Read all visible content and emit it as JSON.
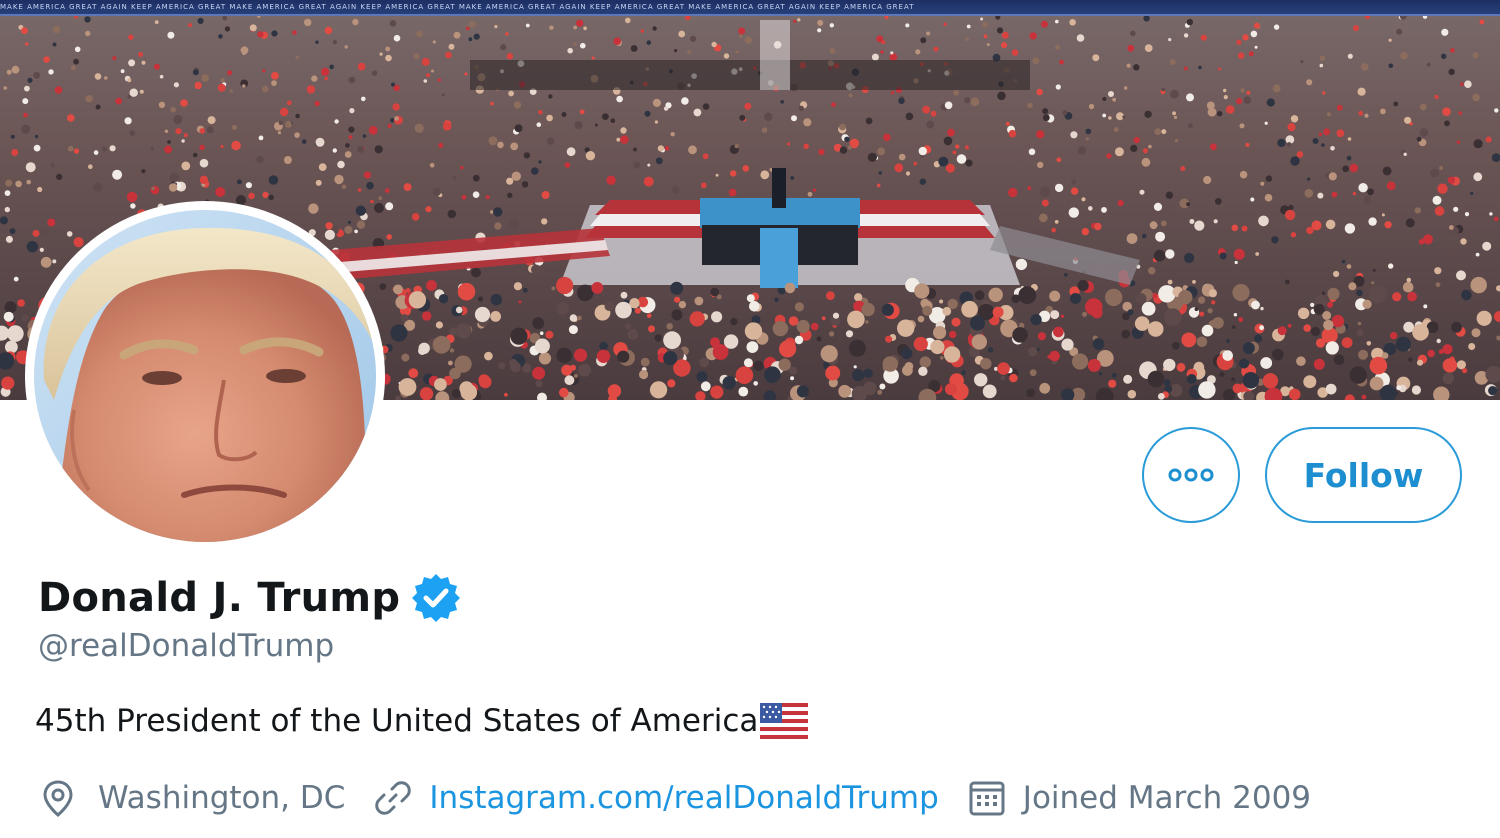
{
  "banner": {
    "ticker_text": "MAKE AMERICA GREAT AGAIN   KEEP AMERICA GREAT   MAKE AMERICA GREAT AGAIN   KEEP AMERICA GREAT   MAKE AMERICA GREAT AGAIN   KEEP AMERICA GREAT   MAKE AMERICA GREAT AGAIN   KEEP AMERICA GREAT"
  },
  "actions": {
    "follow_label": "Follow",
    "more_icon": "more-dots-icon"
  },
  "profile": {
    "display_name": "Donald J. Trump",
    "verified": true,
    "handle": "@realDonaldTrump",
    "bio": "45th President of the United States of America",
    "bio_emoji": "us-flag-icon",
    "location": "Washington, DC",
    "website": "Instagram.com/realDonaldTrump",
    "joined": "Joined March 2009"
  },
  "colors": {
    "accent": "#1da1f2",
    "link": "#1b95e0",
    "secondary_text": "#657786",
    "primary_text": "#14171a"
  }
}
